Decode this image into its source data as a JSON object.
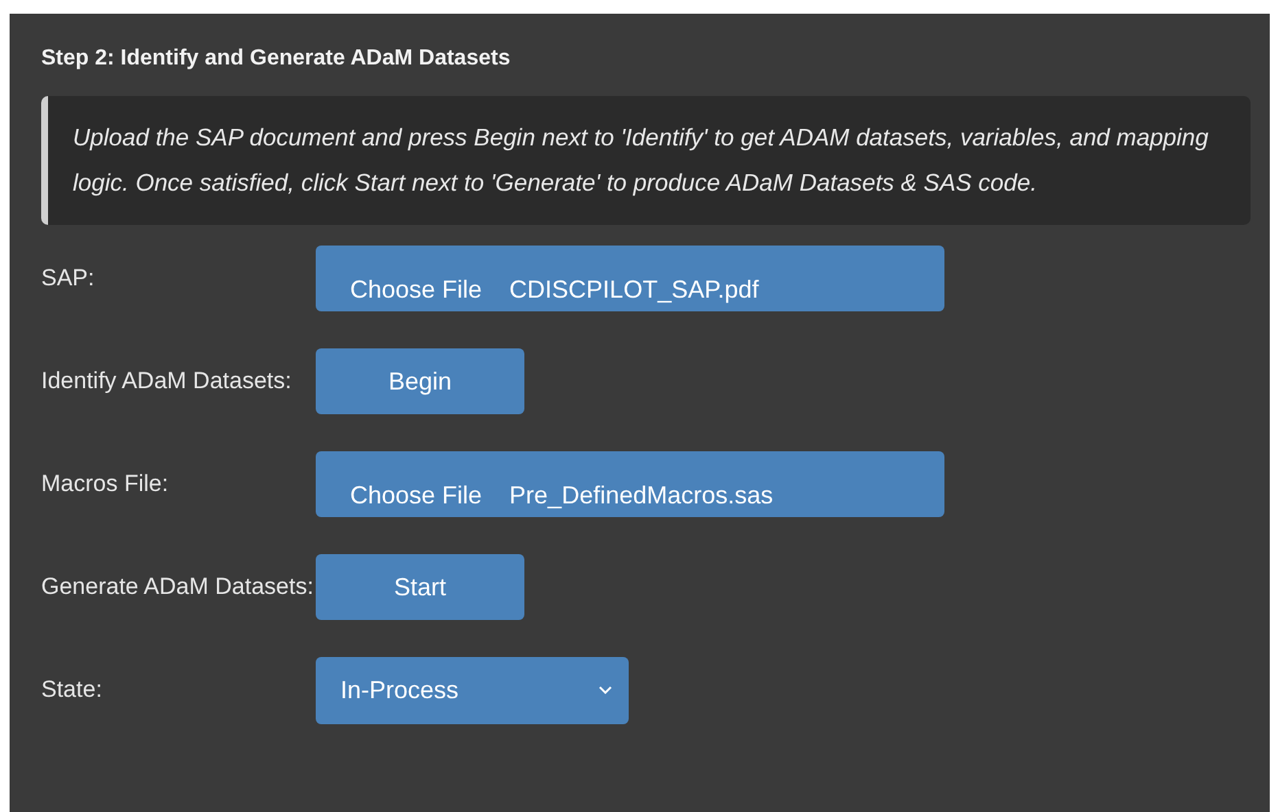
{
  "heading": "Step 2: Identify and Generate ADaM Datasets",
  "note": "Upload the SAP document and press Begin next to 'Identify' to get ADAM datasets, variables, and mapping logic. Once satisfied, click Start next to 'Generate' to produce ADaM Datasets & SAS code.",
  "rows": [
    {
      "kind": "file",
      "label": "SAP:",
      "button": "Choose File",
      "value": "CDISCPILOT_SAP.pdf"
    },
    {
      "kind": "button",
      "label": "Identify ADaM Datasets:",
      "button": "Begin"
    },
    {
      "kind": "file",
      "label": "Macros File:",
      "button": "Choose File",
      "value": "Pre_DefinedMacros.sas"
    },
    {
      "kind": "button",
      "label": "Generate ADaM Datasets:",
      "button": "Start"
    },
    {
      "kind": "select",
      "label": "State:",
      "value": "In-Process"
    }
  ]
}
